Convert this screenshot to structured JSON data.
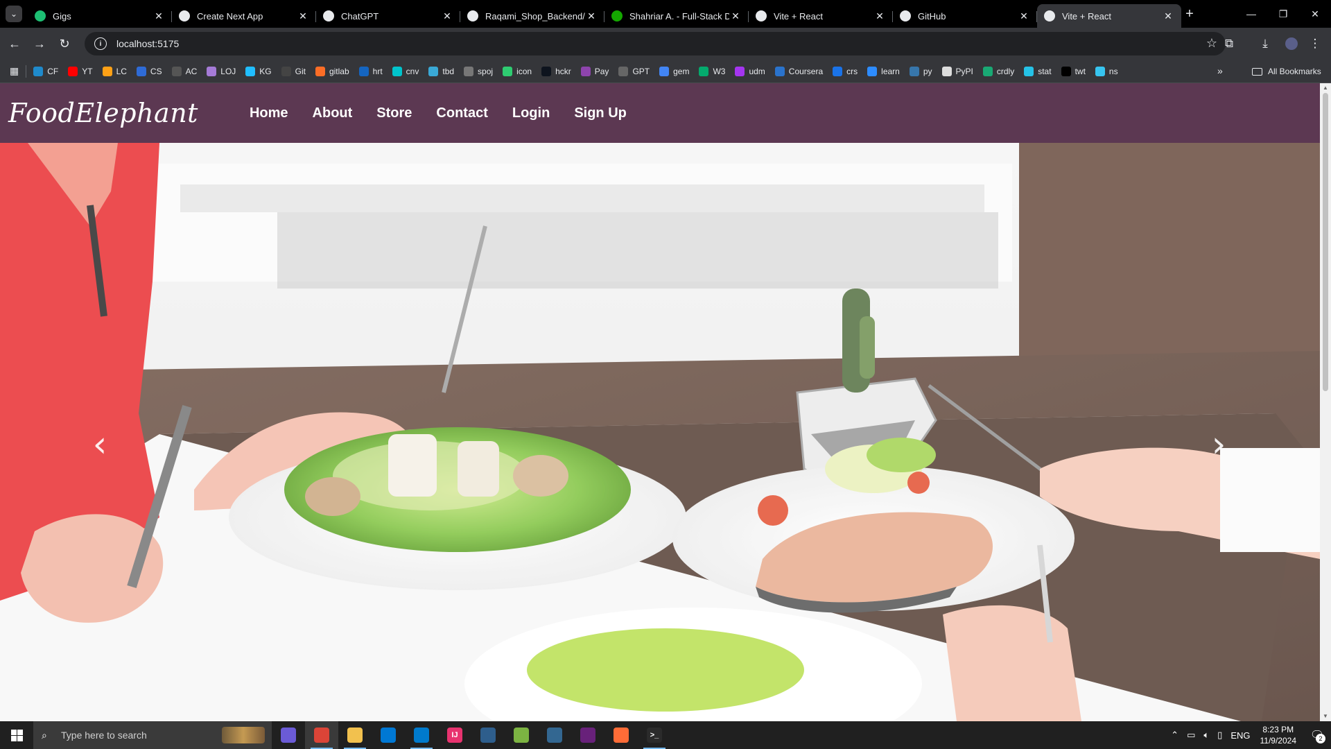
{
  "browser": {
    "tabs": [
      {
        "title": "Gigs",
        "favicon": "fiverr-icon",
        "fav_color": "#1dbf73"
      },
      {
        "title": "Create Next App",
        "favicon": "globe-icon",
        "fav_color": "#e8eaed"
      },
      {
        "title": "ChatGPT",
        "favicon": "openai-icon",
        "fav_color": "#e8eaed"
      },
      {
        "title": "Raqami_Shop_Backend/sr",
        "favicon": "github-icon",
        "fav_color": "#e8eaed"
      },
      {
        "title": "Shahriar A. - Full-Stack De",
        "favicon": "upwork-icon",
        "fav_color": "#14a800"
      },
      {
        "title": "Vite + React",
        "favicon": "globe-icon",
        "fav_color": "#e8eaed"
      },
      {
        "title": "GitHub",
        "favicon": "github-icon",
        "fav_color": "#e8eaed"
      },
      {
        "title": "Vite + React",
        "favicon": "globe-icon",
        "fav_color": "#e8eaed",
        "active": true
      }
    ],
    "url": "localhost:5175",
    "bookmarks": [
      {
        "label": "CF",
        "color": "#1f8acb"
      },
      {
        "label": "YT",
        "color": "#ff0000"
      },
      {
        "label": "LC",
        "color": "#ffa116"
      },
      {
        "label": "CS",
        "color": "#2e6bd6"
      },
      {
        "label": "AC",
        "color": "#555555"
      },
      {
        "label": "LOJ",
        "color": "#a57bd7"
      },
      {
        "label": "KG",
        "color": "#20beff"
      },
      {
        "label": "Git",
        "color": "#444444"
      },
      {
        "label": "gitlab",
        "color": "#fc6d26"
      },
      {
        "label": "hrt",
        "color": "#1565c0"
      },
      {
        "label": "cnv",
        "color": "#00c4cc"
      },
      {
        "label": "tbd",
        "color": "#3aa9d6"
      },
      {
        "label": "spoj",
        "color": "#777777"
      },
      {
        "label": "icon",
        "color": "#2ecc71"
      },
      {
        "label": "hckr",
        "color": "#0e141e"
      },
      {
        "label": "Pay",
        "color": "#8e44ad"
      },
      {
        "label": "GPT",
        "color": "#666666"
      },
      {
        "label": "gem",
        "color": "#4285f4"
      },
      {
        "label": "W3",
        "color": "#04aa6d"
      },
      {
        "label": "udm",
        "color": "#a435f0"
      },
      {
        "label": "Coursera",
        "color": "#2a73cc"
      },
      {
        "label": "crs",
        "color": "#1a73e8"
      },
      {
        "label": "learn",
        "color": "#2d8cff"
      },
      {
        "label": "py",
        "color": "#3776ab"
      },
      {
        "label": "PyPI",
        "color": "#dddddd"
      },
      {
        "label": "crdly",
        "color": "#19a974"
      },
      {
        "label": "stat",
        "color": "#25c2e6"
      },
      {
        "label": "twt",
        "color": "#000000"
      },
      {
        "label": "ns",
        "color": "#37c5f0"
      }
    ],
    "all_bookmarks": "All Bookmarks"
  },
  "site": {
    "brand": "FoodElephant",
    "nav": [
      "Home",
      "About",
      "Store",
      "Contact",
      "Login",
      "Sign Up"
    ],
    "nav_bg": "#5c3852",
    "carousel_prev": "‹",
    "carousel_next": "›"
  },
  "taskbar": {
    "search_placeholder": "Type here to search",
    "apps": [
      {
        "name": "copilot-icon",
        "color": "#6b5bd6",
        "label": "",
        "running": false
      },
      {
        "name": "chrome-icon",
        "color": "#db4437",
        "label": "",
        "running": true,
        "active": true
      },
      {
        "name": "file-explorer-icon",
        "color": "#f2c14e",
        "label": "",
        "running": true
      },
      {
        "name": "store-icon",
        "color": "#0078d4",
        "label": "",
        "running": false
      },
      {
        "name": "vscode-icon",
        "color": "#007acc",
        "label": "",
        "running": true
      },
      {
        "name": "intellij-icon",
        "color": "#e8336f",
        "label": "IJ",
        "running": false
      },
      {
        "name": "mysql-workbench-icon",
        "color": "#2e5e8c",
        "label": "",
        "running": false
      },
      {
        "name": "snipping-tool-icon",
        "color": "#7cb342",
        "label": "",
        "running": false
      },
      {
        "name": "postgres-icon",
        "color": "#336791",
        "label": "",
        "running": false
      },
      {
        "name": "visual-studio-icon",
        "color": "#68217a",
        "label": "",
        "running": false
      },
      {
        "name": "postman-icon",
        "color": "#ff6c37",
        "label": "",
        "running": false
      },
      {
        "name": "terminal-icon",
        "color": "#2b2b2b",
        "label": ">_",
        "running": true
      }
    ],
    "language": "ENG",
    "time": "8:23 PM",
    "date": "11/9/2024",
    "notification_count": "2"
  }
}
